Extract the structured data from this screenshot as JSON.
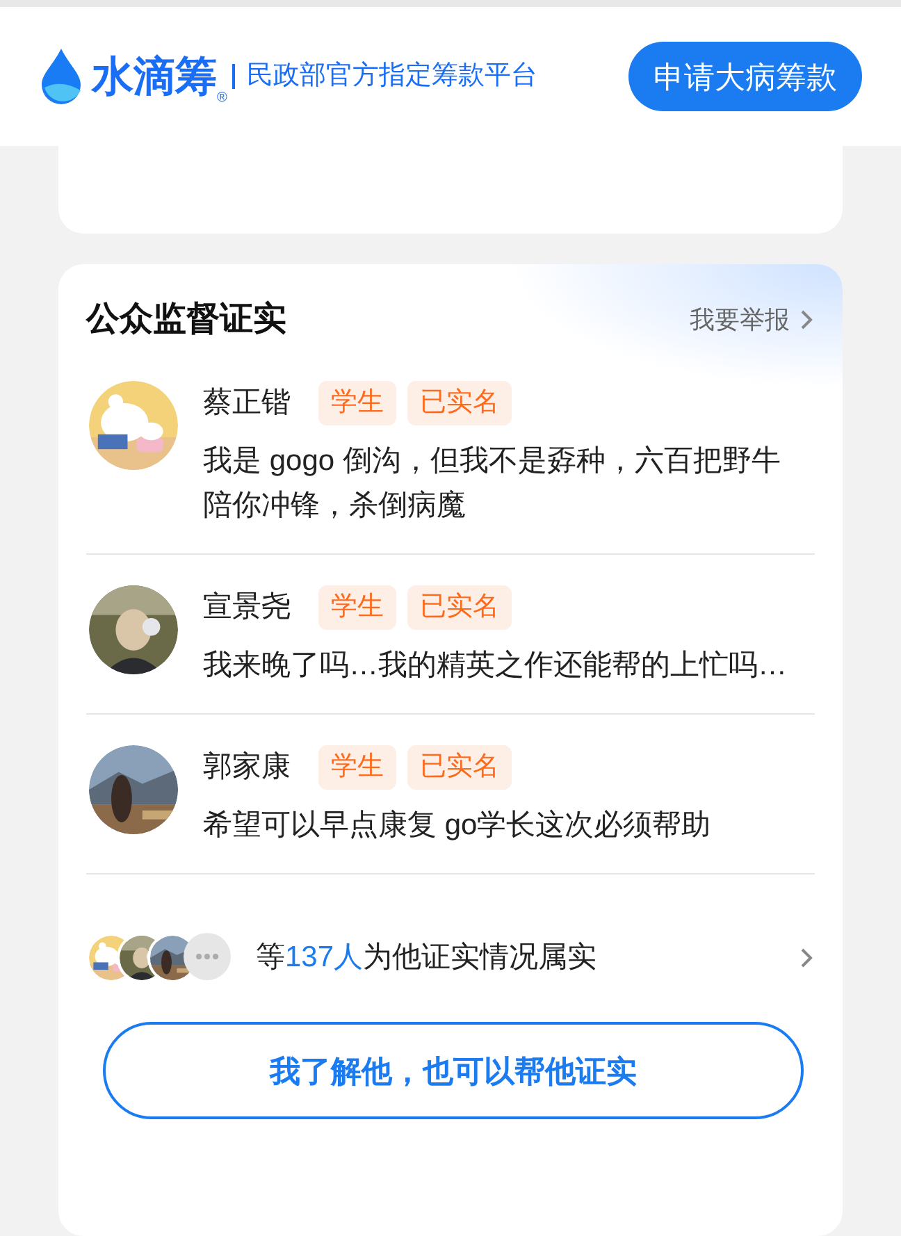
{
  "header": {
    "brand": "水滴筹",
    "registered": "®",
    "slogan": "民政部官方指定筹款平台",
    "apply_button": "申请大病筹款"
  },
  "section": {
    "title": "公众监督证实",
    "report_link": "我要举报"
  },
  "testimonials": [
    {
      "name": "蔡正锴",
      "tags": [
        "学生",
        "已实名"
      ],
      "text": "我是 gogo 倒沟，但我不是孬种，六百把野牛陪你冲锋，杀倒病魔"
    },
    {
      "name": "宣景尧",
      "tags": [
        "学生",
        "已实名"
      ],
      "text": "我来晚了吗…我的精英之作还能帮的上忙吗…"
    },
    {
      "name": "郭家康",
      "tags": [
        "学生",
        "已实名"
      ],
      "text": "希望可以早点康复 go学长这次必须帮助"
    }
  ],
  "summary": {
    "prefix": "等",
    "count": "137人",
    "suffix": "为他证实情况属实"
  },
  "verify_button": "我了解他，也可以帮他证实"
}
